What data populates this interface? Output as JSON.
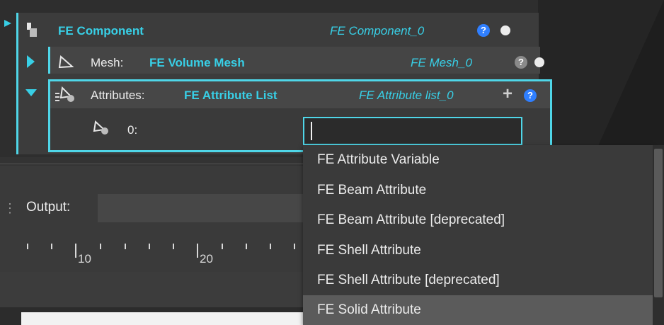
{
  "component": {
    "label": "FE Component",
    "instance": "FE Component_0",
    "help": "?"
  },
  "mesh": {
    "prefix": "Mesh:",
    "type": "FE Volume Mesh",
    "instance": "FE Mesh_0",
    "help": "?"
  },
  "attributes": {
    "prefix": "Attributes:",
    "type": "FE Attribute List",
    "instance": "FE Attribute list_0",
    "add": "+",
    "help": "?",
    "item_index": "0:",
    "item_value": ""
  },
  "output": {
    "label": "Output:",
    "value": ""
  },
  "ruler": {
    "labels": [
      "10",
      "20"
    ]
  },
  "dropdown": {
    "items": [
      "FE Attribute Variable",
      "FE Beam Attribute",
      "FE Beam Attribute [deprecated]",
      "FE Shell Attribute",
      "FE Shell Attribute [deprecated]",
      "FE Solid Attribute"
    ],
    "selected": "FE Solid Attribute"
  },
  "colors": {
    "accent": "#38cfe6",
    "help_blue": "#2f7fff"
  },
  "icons": [
    "component-icon",
    "expand-arrow-icon",
    "mesh-icon",
    "collapse-arrow-icon",
    "attribute-list-icon",
    "attribute-icon",
    "add-icon",
    "help-icon",
    "status-dot-icon"
  ]
}
